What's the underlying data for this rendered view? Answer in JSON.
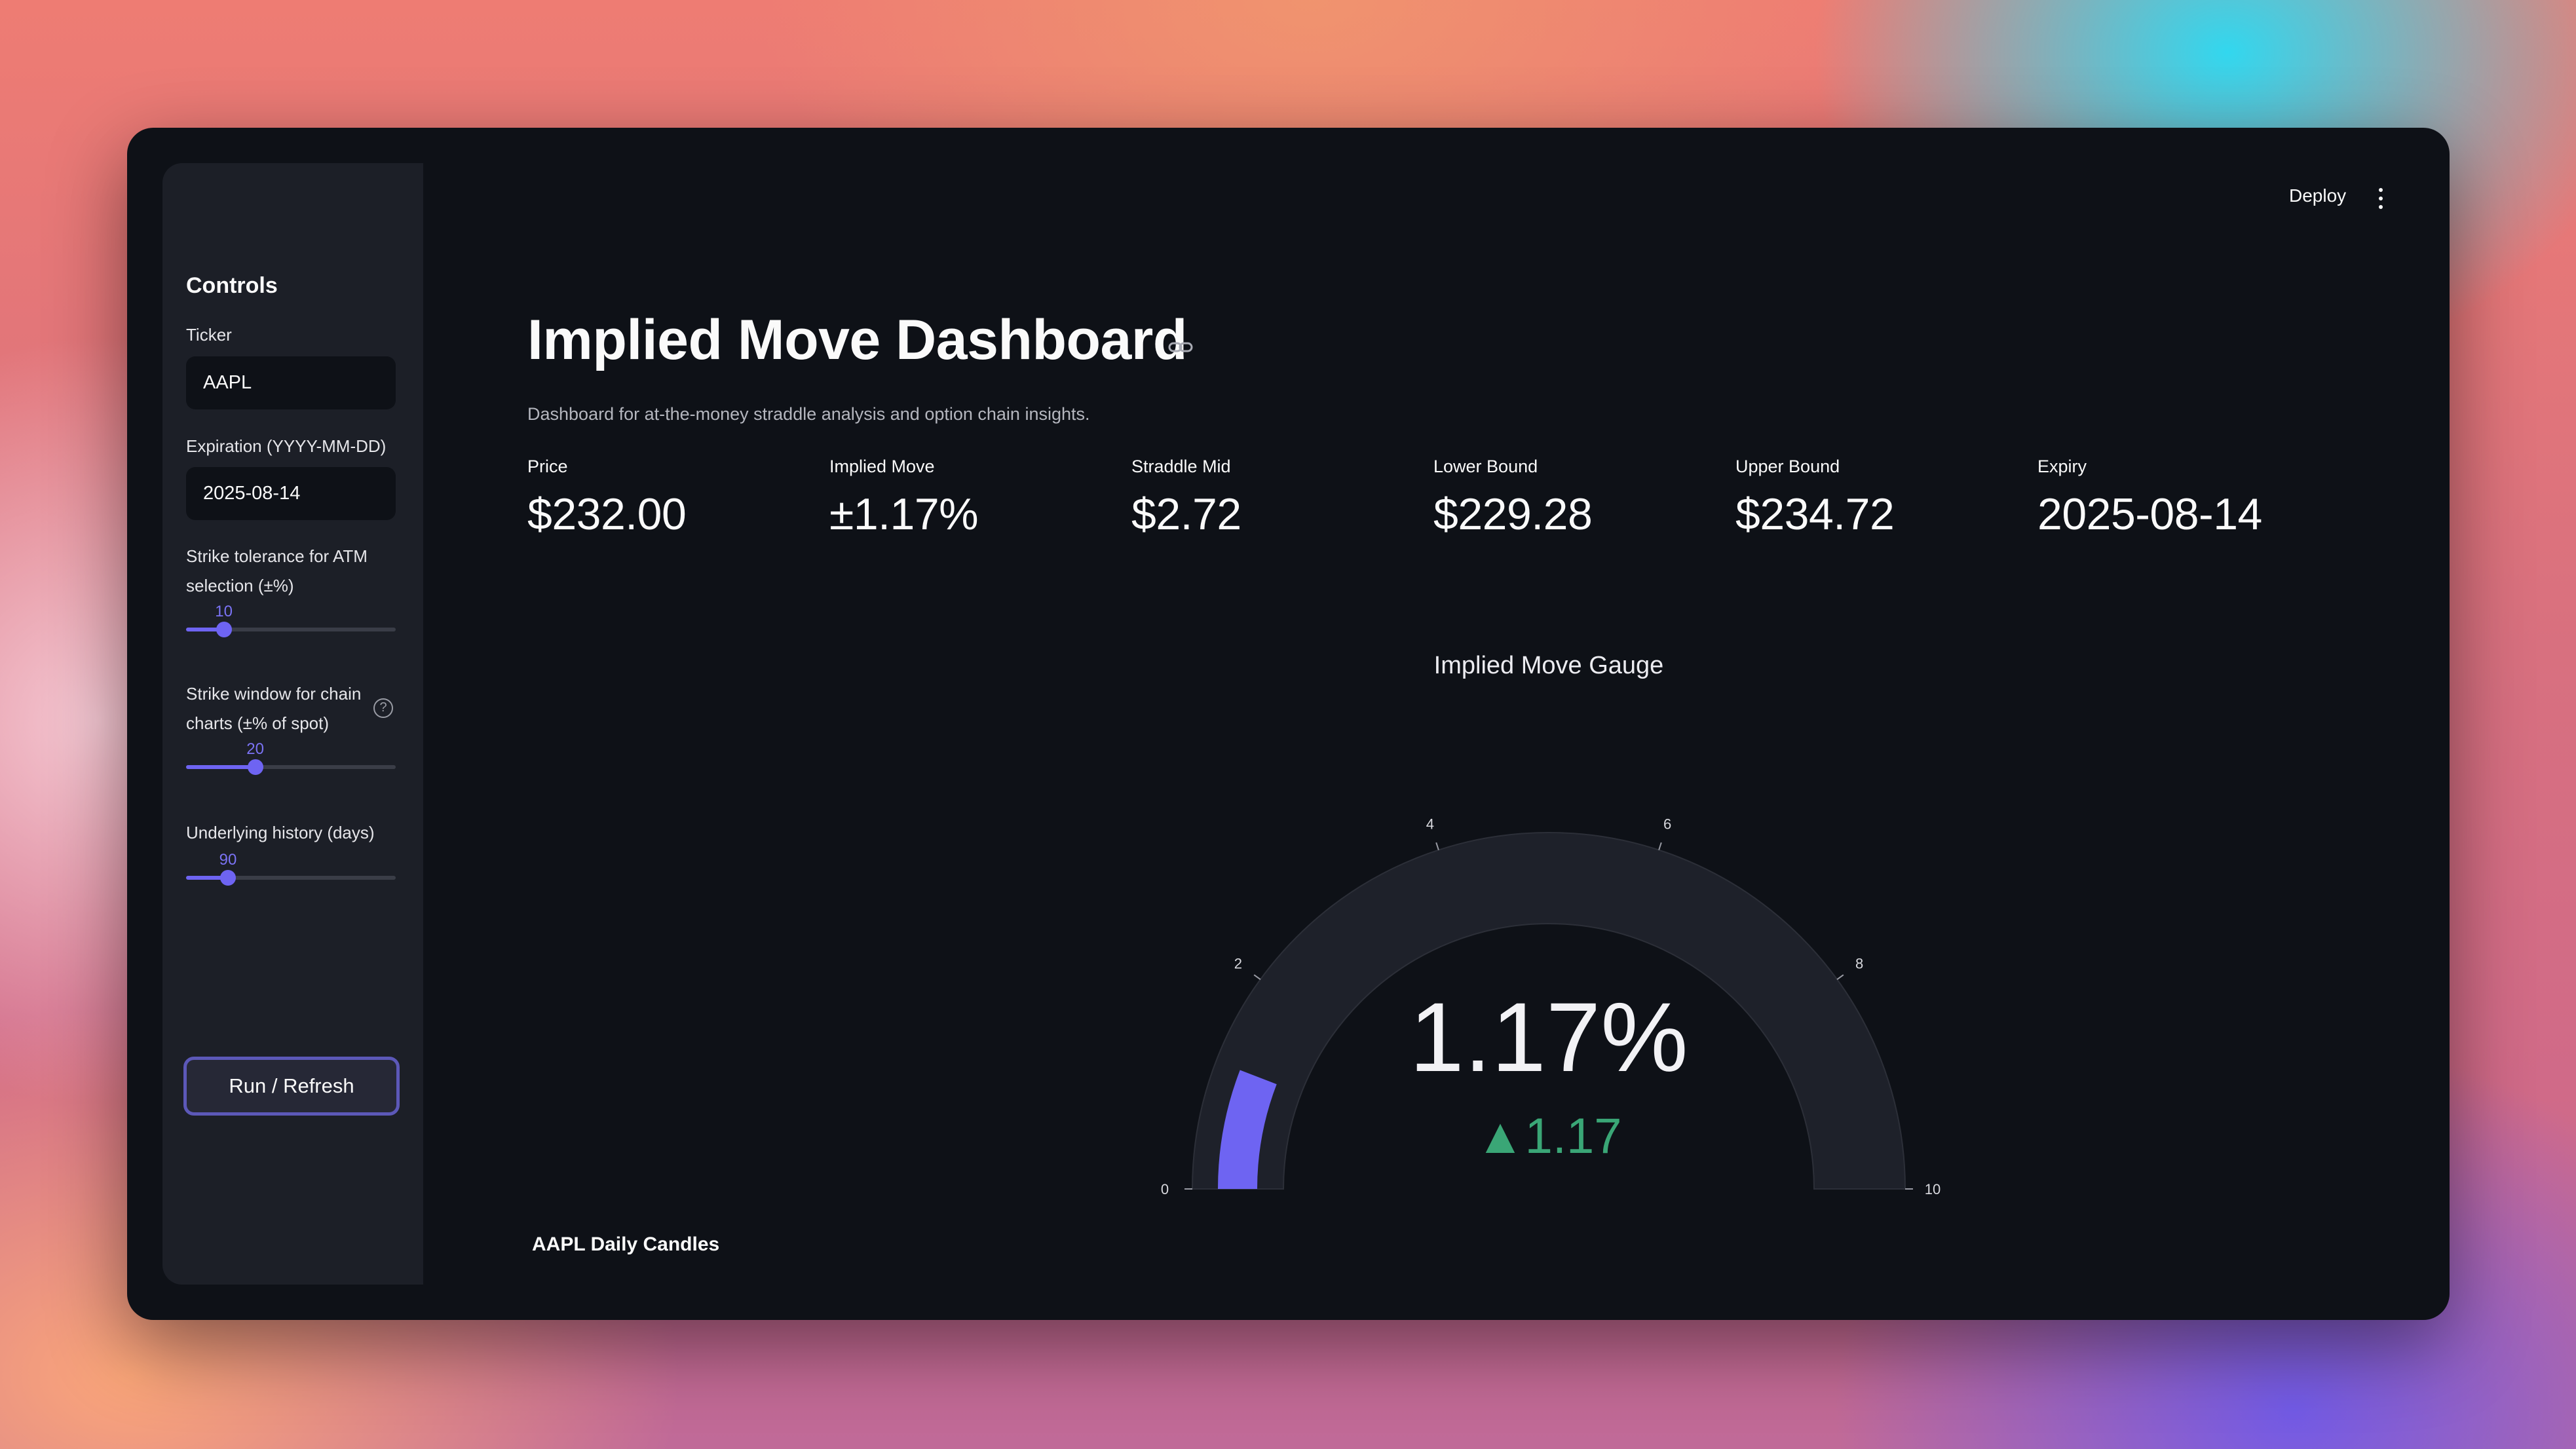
{
  "sidebar": {
    "title": "Controls",
    "ticker_label": "Ticker",
    "ticker_value": "AAPL",
    "expiration_label": "Expiration (YYYY-MM-DD)",
    "expiration_value": "2025-08-14",
    "strike_tolerance": {
      "label_line1": "Strike tolerance for ATM",
      "label_line2": "selection (±%)",
      "value": 10,
      "value_text": "10",
      "fraction": 0.18
    },
    "strike_window": {
      "label_line1": "Strike window for chain",
      "label_line2": "charts (±% of spot)",
      "value": 20,
      "value_text": "20",
      "fraction": 0.33
    },
    "history": {
      "label": "Underlying history (days)",
      "value": 90,
      "value_text": "90",
      "fraction": 0.2
    },
    "run_button": "Run / Refresh"
  },
  "header": {
    "deploy": "Deploy",
    "menu_icon": "kebab-menu-icon"
  },
  "main": {
    "title": "Implied Move Dashboard",
    "subtitle": "Dashboard for at-the-money straddle analysis and option chain insights.",
    "metrics": [
      {
        "label": "Price",
        "value": "$232.00"
      },
      {
        "label": "Implied Move",
        "value": "±1.17%"
      },
      {
        "label": "Straddle Mid",
        "value": "$2.72"
      },
      {
        "label": "Lower Bound",
        "value": "$229.28"
      },
      {
        "label": "Upper Bound",
        "value": "$234.72"
      },
      {
        "label": "Expiry",
        "value": "2025-08-14"
      }
    ],
    "candles_title": "AAPL Daily Candles"
  },
  "gauge": {
    "title": "Implied Move Gauge",
    "value": 1.17,
    "range": [
      0,
      10
    ],
    "ticks": [
      "0",
      "2",
      "4",
      "6",
      "8",
      "10"
    ],
    "value_text": "1.17%",
    "delta_text": "▲1.17",
    "colors": {
      "bar": "#6e64f2",
      "track": "#1e212a",
      "delta": "#3aa676"
    }
  },
  "colors": {
    "app_bg": "#0e1117",
    "sidebar_bg": "#1c1f27",
    "accent": "#6e64f2",
    "text": "#fafafa"
  }
}
